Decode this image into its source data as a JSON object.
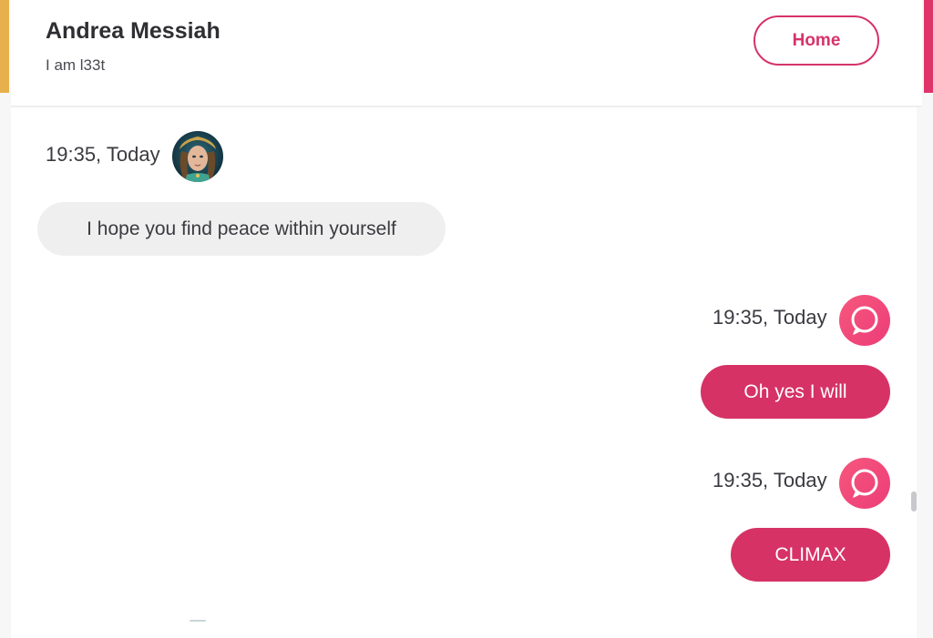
{
  "header": {
    "name": "Andrea Messiah",
    "status": "I am l33t",
    "home_label": "Home"
  },
  "messages": [
    {
      "direction": "incoming",
      "timestamp": "19:35, Today",
      "text": "I hope you find peace within yourself",
      "icon": "avatar"
    },
    {
      "direction": "outgoing",
      "timestamp": "19:35, Today",
      "text": "Oh yes I will",
      "icon": "chat-bubble-icon"
    },
    {
      "direction": "outgoing",
      "timestamp": "19:35, Today",
      "text": "CLIMAX",
      "icon": "chat-bubble-icon"
    }
  ],
  "colors": {
    "accent": "#d63266",
    "left_edge": "#e8b04c",
    "right_edge": "#e0336a",
    "incoming_bubble": "#efefef"
  }
}
